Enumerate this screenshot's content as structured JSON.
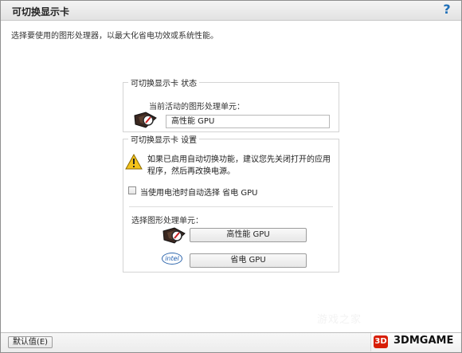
{
  "window": {
    "title": "可切换显示卡",
    "help_icon": "?",
    "description": "选择要使用的图形处理器，以最大化省电功效或系统性能。"
  },
  "status_group": {
    "title": "可切换显示卡 状态",
    "current_label": "当前活动的图形处理单元：",
    "current_value": "高性能 GPU",
    "icon": "gpu-chip-icon"
  },
  "settings_group": {
    "title": "可切换显示卡 设置",
    "warning_icon": "warning-icon",
    "warning_text": "如果已启用自动切换功能，建议您先关闭打开的应用程序，然后再改换电源。",
    "checkbox_label": "当使用电池时自动选择 省电 GPU",
    "select_label": "选择图形处理单元：",
    "high_perf_button": "高性能 GPU",
    "power_saving_button": "省电 GPU",
    "intel_label": "intel"
  },
  "bottom": {
    "default_button": "默认值(E)",
    "apply_button": "3DMGAME",
    "watermark": "游戏之家"
  },
  "colors": {
    "title_bar": "#e2e2e2",
    "accent_blue": "#1f6fb8",
    "brand_red": "#d81e06"
  }
}
